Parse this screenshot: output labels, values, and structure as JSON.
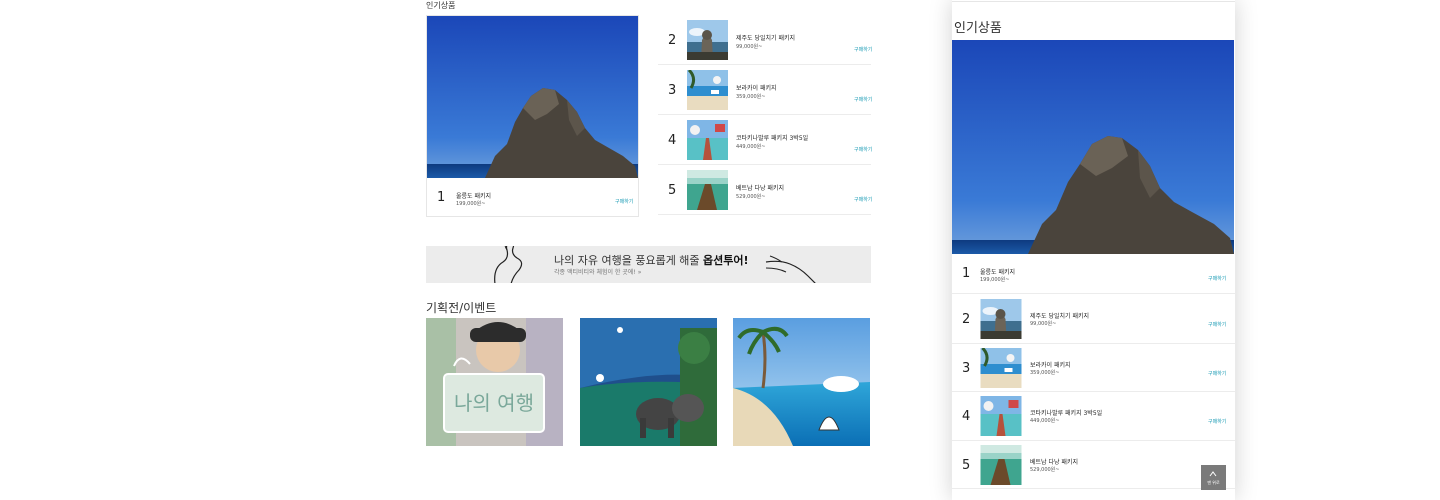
{
  "desktop": {
    "popular_title": "인기상품",
    "products": [
      {
        "rank": "1",
        "name": "울릉도 패키지",
        "price": "199,000원~",
        "buy": "구매하기"
      },
      {
        "rank": "2",
        "name": "제주도 당일치기 패키지",
        "price": "99,000원~",
        "buy": "구매하기"
      },
      {
        "rank": "3",
        "name": "보라카이 패키지",
        "price": "359,000원~",
        "buy": "구매하기"
      },
      {
        "rank": "4",
        "name": "코타키나발루 패키지 3박5일",
        "price": "449,000원~",
        "buy": "구매하기"
      },
      {
        "rank": "5",
        "name": "베트남 다낭 패키지",
        "price": "529,000원~",
        "buy": "구매하기"
      }
    ],
    "banner": {
      "line1_prefix": "나의 자유 여행을 풍요롭게 해줄 ",
      "line1_bold": "옵션투어!",
      "line2": "각종 액티비티와 체험이 한 곳에! »"
    },
    "events_title": "기획전/이벤트",
    "event1_text": "나의 여행"
  },
  "mobile": {
    "popular_title": "인기상품",
    "products": [
      {
        "rank": "1",
        "name": "울릉도 패키지",
        "price": "199,000원~",
        "buy": "구매하기"
      },
      {
        "rank": "2",
        "name": "제주도 당일치기 패키지",
        "price": "99,000원~",
        "buy": "구매하기"
      },
      {
        "rank": "3",
        "name": "보라카이 패키지",
        "price": "359,000원~",
        "buy": "구매하기"
      },
      {
        "rank": "4",
        "name": "코타키나발루 패키지 3박5일",
        "price": "449,000원~",
        "buy": "구매하기"
      },
      {
        "rank": "5",
        "name": "베트남 다낭 패키지",
        "price": "529,000원~",
        "buy": "구매하기"
      }
    ],
    "top_button_label": "맨 위로"
  },
  "colors": {
    "accent": "#1a9bb5",
    "sky": "#2a63c4",
    "banner_bg": "#ececec",
    "top_button_bg": "#7a7a7a"
  },
  "icons": {
    "top_button": "chevron-up-icon"
  }
}
